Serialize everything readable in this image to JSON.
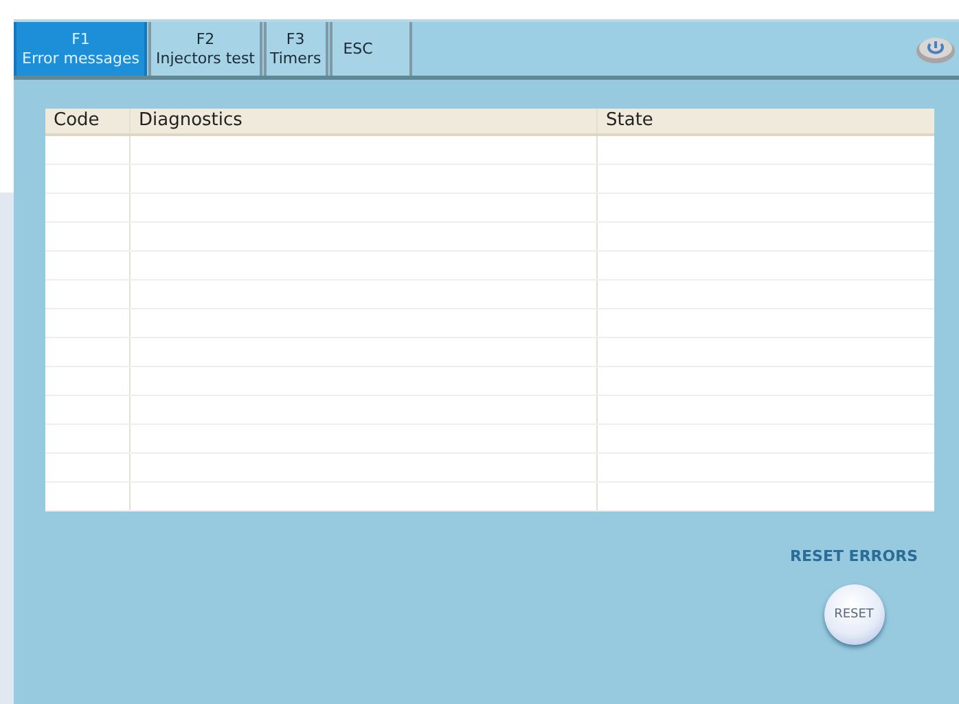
{
  "tabs": [
    {
      "key": "F1",
      "label": "Error messages",
      "selected": true
    },
    {
      "key": "F2",
      "label": "Injectors test",
      "selected": false
    },
    {
      "key": "F3",
      "label": "Timers",
      "selected": false
    },
    {
      "key": "ESC",
      "selected": false
    }
  ],
  "table": {
    "columns": [
      "Code",
      "Diagnostics",
      "State"
    ]
  },
  "reset": {
    "title": "RESET ERRORS",
    "button": "RESET"
  }
}
